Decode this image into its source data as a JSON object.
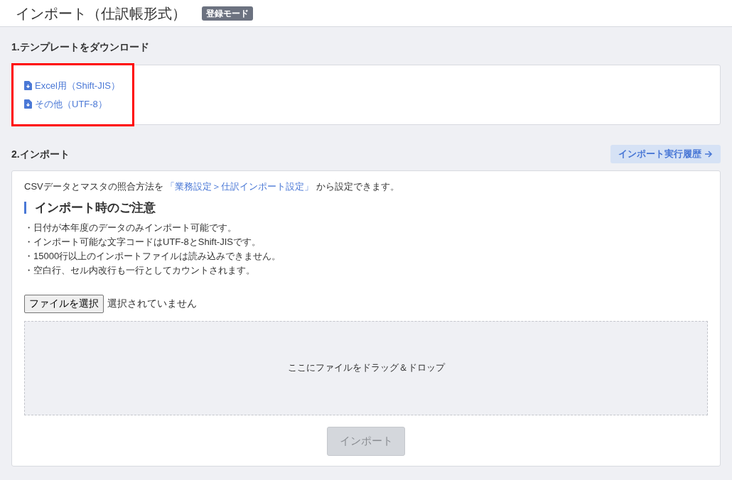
{
  "header": {
    "title": "インポート（仕訳帳形式）",
    "badge": "登録モード"
  },
  "template_section": {
    "heading": "1.テンプレートをダウンロード",
    "links": [
      {
        "label": "Excel用（Shift-JIS）"
      },
      {
        "label": "その他（UTF-8）"
      }
    ]
  },
  "import_section": {
    "heading": "2.インポート",
    "history_button": "インポート実行履歴",
    "intro": {
      "before": "CSVデータとマスタの照合方法を",
      "link": "「業務設定＞仕訳インポート設定」",
      "after": "から設定できます。"
    },
    "notes_heading": "インポート時のご注意",
    "notes": [
      "・日付が本年度のデータのみインポート可能です。",
      "・インポート可能な文字コードはUTF-8とShift-JISです。",
      "・15000行以上のインポートファイルは読み込みできません。",
      "・空白行、セル内改行も一行としてカウントされます。"
    ],
    "file_button": "ファイルを選択",
    "file_status": "選択されていません",
    "drop_zone": "ここにファイルをドラッグ＆ドロップ",
    "import_button": {
      "label": "インポート",
      "disabled": true
    }
  }
}
